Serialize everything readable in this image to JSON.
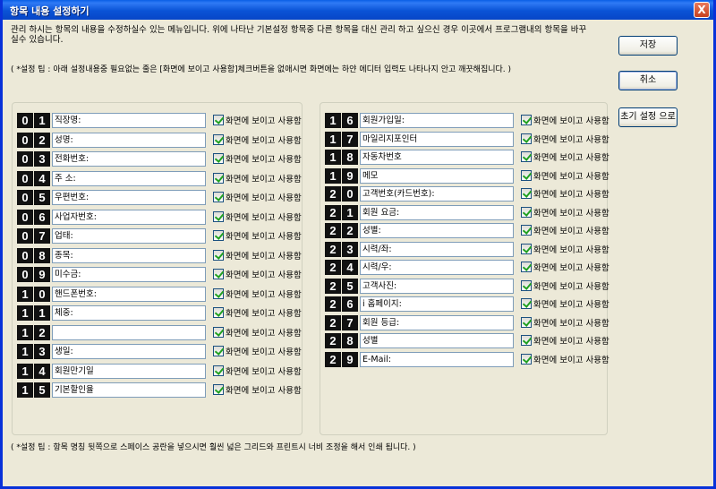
{
  "window": {
    "title": "항목 내용 설정하기",
    "close_symbol": "X"
  },
  "description": "관리 하시는 항목의 내용을 수정하실수 있는 메뉴입니다. 위에 나타난 기본설정 항목중 다른 항목을 대신 관리 하고 싶으신 경우 이곳에서 프로그램내의 항목을 바꾸실수 있습니다.",
  "tip_top": "( *설정 팁 : 아래 설정내용중 필요없는 줄은 [화면에 보이고 사용함]체크버튼을 없애시면 화면에는 하얀 에디터 입력도 나타나지 안고 깨끗해집니다. )",
  "tip_bottom": "( *설정 팁 : 항목 명칭 뒷쪽으로 스페이스 공란을 넣으시면 훨씬 넓은 그리드와 프린트시 너비 조정을 해서 인쇄 됩니다. )",
  "buttons": {
    "save": "저장",
    "cancel": "취소",
    "reset": "초기 설정 으로"
  },
  "checkbox_label": "화면에 보이고 사용함",
  "left_items": [
    {
      "n1": "0",
      "n2": "1",
      "value": "직장명:"
    },
    {
      "n1": "0",
      "n2": "2",
      "value": "성명:"
    },
    {
      "n1": "0",
      "n2": "3",
      "value": "전화번호:"
    },
    {
      "n1": "0",
      "n2": "4",
      "value": "주  소:"
    },
    {
      "n1": "0",
      "n2": "5",
      "value": "우편번호:"
    },
    {
      "n1": "0",
      "n2": "6",
      "value": "사업자번호:"
    },
    {
      "n1": "0",
      "n2": "7",
      "value": "업태:"
    },
    {
      "n1": "0",
      "n2": "8",
      "value": "종목:"
    },
    {
      "n1": "0",
      "n2": "9",
      "value": "미수금:"
    },
    {
      "n1": "1",
      "n2": "0",
      "value": "핸드폰번호:"
    },
    {
      "n1": "1",
      "n2": "1",
      "value": "체중:"
    },
    {
      "n1": "1",
      "n2": "2",
      "value": ""
    },
    {
      "n1": "1",
      "n2": "3",
      "value": "생일:"
    },
    {
      "n1": "1",
      "n2": "4",
      "value": "회원만기일"
    },
    {
      "n1": "1",
      "n2": "5",
      "value": "기본할인율"
    }
  ],
  "right_items": [
    {
      "n1": "1",
      "n2": "6",
      "value": "회원가입일:"
    },
    {
      "n1": "1",
      "n2": "7",
      "value": "마일리지포인터"
    },
    {
      "n1": "1",
      "n2": "8",
      "value": "자동차번호"
    },
    {
      "n1": "1",
      "n2": "9",
      "value": "메모"
    },
    {
      "n1": "2",
      "n2": "0",
      "value": "고객번호(카드번호):"
    },
    {
      "n1": "2",
      "n2": "1",
      "value": "회원 요금:"
    },
    {
      "n1": "2",
      "n2": "2",
      "value": "성별:"
    },
    {
      "n1": "2",
      "n2": "3",
      "value": "시력/좌:"
    },
    {
      "n1": "2",
      "n2": "4",
      "value": "시력/우:"
    },
    {
      "n1": "2",
      "n2": "5",
      "value": "고객사진:"
    },
    {
      "n1": "2",
      "n2": "6",
      "value": "i 홈페이지:"
    },
    {
      "n1": "2",
      "n2": "7",
      "value": "회원 등급:"
    },
    {
      "n1": "2",
      "n2": "8",
      "value": "성별"
    },
    {
      "n1": "2",
      "n2": "9",
      "value": "E-Mail:"
    }
  ]
}
